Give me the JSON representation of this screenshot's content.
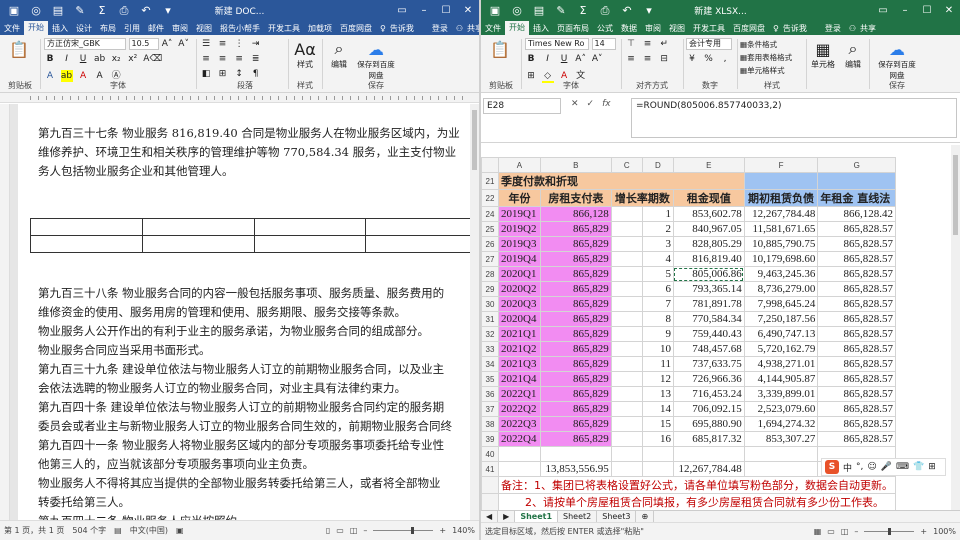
{
  "word": {
    "title": "新建 DOC...",
    "login": "登录",
    "share": "共享",
    "tabs": [
      "文件",
      "开始",
      "插入",
      "设计",
      "布局",
      "引用",
      "邮件",
      "审阅",
      "视图",
      "报告小帮手",
      "开发工具",
      "加载项",
      "百度网盘",
      "告诉我"
    ],
    "ribbon": {
      "font_name": "方正仿宋_GBK",
      "font_size": "10.5",
      "style_label": "样式",
      "edit_label": "编辑",
      "save_label": "保存到百度网盘",
      "groups": [
        "剪贴板",
        "字体",
        "段落",
        "样式",
        "保存"
      ]
    },
    "paragraphs": [
      "第九百三十七条 物业服务 816,819.40 合同是物业服务人在物业服务区域内，为业",
      "维修养护、环境卫生和相关秩序的管理维护等物 770,584.34 服务，业主支付物业",
      "务人包括物业服务企业和其他管理人。",
      "第九百三十八条 物业服务合同的内容一般包括服务事项、服务质量、服务费用的",
      "维修资金的使用、服务用房的管理和使用、服务期限、服务交接等条款。",
      "物业服务人公开作出的有利于业主的服务承诺，为物业服务合同的组成部分。",
      "物业服务合同应当采用书面形式。",
      "第九百三十九条 建设单位依法与物业服务人订立的前期物业服务合同，以及业主",
      "会依法选聘的物业服务人订立的物业服务合同，对业主具有法律约束力。",
      "第九百四十条 建设单位依法与物业服务人订立的前期物业服务合同约定的服务期",
      "委员会或者业主与新物业服务人订立的物业服务合同生效的，前期物业服务合同终",
      "第九百四十一条 物业服务人将物业服务区域内的部分专项服务事项委托给专业性",
      "他第三人的，应当就该部分专项服务事项向业主负责。",
      "物业服务人不得将其应当提供的全部物业服务转委托给第三人，或者将全部物业",
      "转委托给第三人。",
      "第九百四十二条 物业服务人应当按照约"
    ],
    "status": {
      "page": "第 1 页，共 1 页",
      "words": "504 个字",
      "lang": "中文(中国)",
      "zoom": "140%"
    }
  },
  "excel": {
    "title": "新建 XLSX...",
    "login": "登录",
    "share": "共享",
    "tabs": [
      "文件",
      "开始",
      "插入",
      "页面布局",
      "公式",
      "数据",
      "审阅",
      "视图",
      "开发工具",
      "百度网盘",
      "告诉我"
    ],
    "ribbon": {
      "font_name": "Times New Ro",
      "font_size": "14",
      "number_format": "会计专用",
      "cond_format": "条件格式",
      "table_format": "套用表格格式",
      "cell_style": "单元格样式",
      "cells_label": "单元格",
      "edit_label": "编辑",
      "save_label": "保存到百度网盘",
      "groups": [
        "剪贴板",
        "字体",
        "对齐方式",
        "数字",
        "样式",
        "保存"
      ]
    },
    "name_box": "E28",
    "formula": "=ROUND(805006.857740033,2)",
    "columns": [
      "A",
      "B",
      "C",
      "D",
      "E",
      "F",
      "G"
    ],
    "sheet": {
      "title_row": {
        "num": "21",
        "text": "季度付款和折现"
      },
      "header_row": {
        "num": "22",
        "cols": [
          "年份",
          "房租支付表",
          "增长率期数",
          "租金现值",
          "期初租赁负债",
          "年租金 直线法"
        ]
      },
      "rows": [
        {
          "num": "24",
          "q": "2019Q1",
          "pay": "866,128",
          "n": "1",
          "pv": "853,602.78",
          "lia": "12,267,784.48",
          "st": "866,128.42"
        },
        {
          "num": "25",
          "q": "2019Q2",
          "pay": "865,829",
          "n": "2",
          "pv": "840,967.05",
          "lia": "11,581,671.65",
          "st": "865,828.57"
        },
        {
          "num": "26",
          "q": "2019Q3",
          "pay": "865,829",
          "n": "3",
          "pv": "828,805.29",
          "lia": "10,885,790.75",
          "st": "865,828.57"
        },
        {
          "num": "27",
          "q": "2019Q4",
          "pay": "865,829",
          "n": "4",
          "pv": "816,819.40",
          "lia": "10,179,698.60",
          "st": "865,828.57"
        },
        {
          "num": "28",
          "q": "2020Q1",
          "pay": "865,829",
          "n": "5",
          "pv": "805,006.86",
          "lia": "9,463,245.36",
          "st": "865,828.57"
        },
        {
          "num": "29",
          "q": "2020Q2",
          "pay": "865,829",
          "n": "6",
          "pv": "793,365.14",
          "lia": "8,736,279.00",
          "st": "865,828.57"
        },
        {
          "num": "30",
          "q": "2020Q3",
          "pay": "865,829",
          "n": "7",
          "pv": "781,891.78",
          "lia": "7,998,645.24",
          "st": "865,828.57"
        },
        {
          "num": "31",
          "q": "2020Q4",
          "pay": "865,829",
          "n": "8",
          "pv": "770,584.34",
          "lia": "7,250,187.56",
          "st": "865,828.57"
        },
        {
          "num": "32",
          "q": "2021Q1",
          "pay": "865,829",
          "n": "9",
          "pv": "759,440.43",
          "lia": "6,490,747.13",
          "st": "865,828.57"
        },
        {
          "num": "33",
          "q": "2021Q2",
          "pay": "865,829",
          "n": "10",
          "pv": "748,457.68",
          "lia": "5,720,162.79",
          "st": "865,828.57"
        },
        {
          "num": "34",
          "q": "2021Q3",
          "pay": "865,829",
          "n": "11",
          "pv": "737,633.75",
          "lia": "4,938,271.01",
          "st": "865,828.57"
        },
        {
          "num": "35",
          "q": "2021Q4",
          "pay": "865,829",
          "n": "12",
          "pv": "726,966.36",
          "lia": "4,144,905.87",
          "st": "865,828.57"
        },
        {
          "num": "36",
          "q": "2022Q1",
          "pay": "865,829",
          "n": "13",
          "pv": "716,453.24",
          "lia": "3,339,899.01",
          "st": "865,828.57"
        },
        {
          "num": "37",
          "q": "2022Q2",
          "pay": "865,829",
          "n": "14",
          "pv": "706,092.15",
          "lia": "2,523,079.60",
          "st": "865,828.57"
        },
        {
          "num": "38",
          "q": "2022Q3",
          "pay": "865,829",
          "n": "15",
          "pv": "695,880.90",
          "lia": "1,694,274.32",
          "st": "865,828.57"
        },
        {
          "num": "39",
          "q": "2022Q4",
          "pay": "865,829",
          "n": "16",
          "pv": "685,817.32",
          "lia": "853,307.27",
          "st": "865,828.57"
        }
      ],
      "blank_row": "40",
      "total_row": {
        "num": "41",
        "pay": "13,853,556.95",
        "pv": "12,267,784.48"
      },
      "note1": "备注：1、集团已将表格设置好公式，请各单位填写粉色部分，数据会自动更新。",
      "note2": "2、请按单个房屋租赁合同填报，有多少房屋租赁合同就有多少份工作表。"
    },
    "sheet_tabs": [
      "Sheet1",
      "Sheet2",
      "Sheet3"
    ],
    "ime": "中",
    "status": {
      "msg": "选定目标区域，然后按 ENTER 或选择\"粘贴\"",
      "zoom": "100%"
    }
  }
}
